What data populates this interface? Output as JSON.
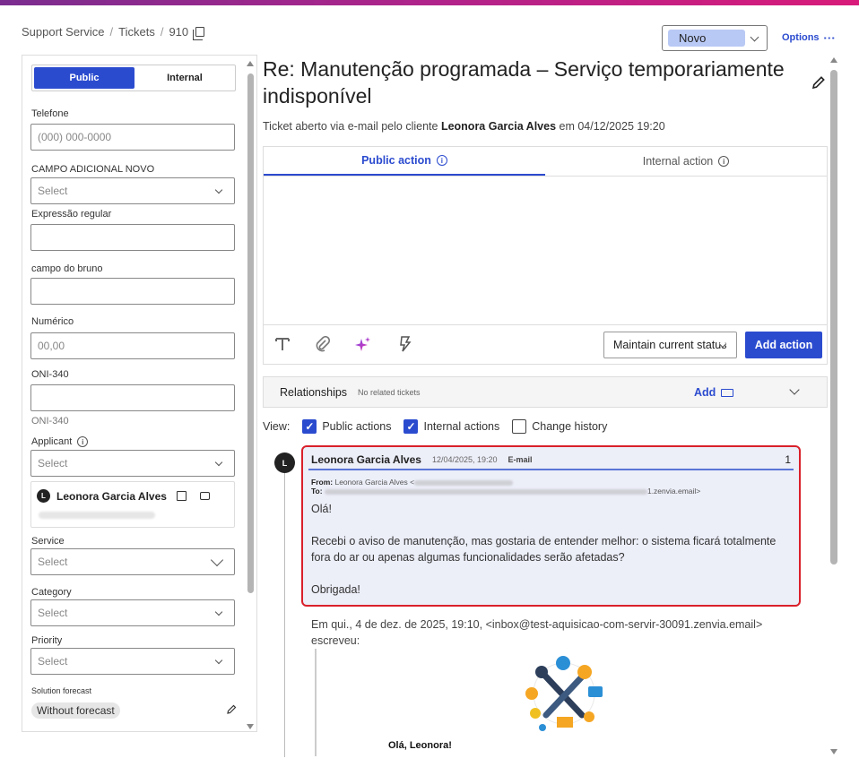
{
  "breadcrumb": {
    "root": "Support Service",
    "section": "Tickets",
    "id": "910"
  },
  "status": {
    "value": "Novo"
  },
  "options_label": "Options",
  "left": {
    "toggle": {
      "public": "Public",
      "internal": "Internal"
    },
    "fields": {
      "telefone": {
        "label": "Telefone",
        "placeholder": "(000) 000-0000"
      },
      "campo_adicional": {
        "label": "CAMPO ADICIONAL NOVO",
        "value": "Select"
      },
      "expressao": {
        "label": "Expressão regular"
      },
      "campo_bruno": {
        "label": "campo do bruno"
      },
      "numerico": {
        "label": "Numérico",
        "placeholder": "00,00"
      },
      "oni": {
        "label": "ONI-340",
        "helper": "ONI-340"
      },
      "applicant": {
        "label": "Applicant",
        "value": "Select"
      },
      "service": {
        "label": "Service",
        "value": "Select"
      },
      "category": {
        "label": "Category",
        "value": "Select"
      },
      "priority": {
        "label": "Priority",
        "value": "Select"
      },
      "solution": {
        "label": "Solution forecast",
        "value": "Without forecast"
      }
    },
    "applicant_card": {
      "initial": "L",
      "name": "Leonora Garcia Alves"
    }
  },
  "ticket": {
    "title": "Re: Manutenção programada – Serviço temporariamente indisponível",
    "subtitle_prefix": "Ticket aberto via e-mail pelo cliente",
    "subtitle_name": "Leonora Garcia Alves",
    "subtitle_suffix": "em 04/12/2025 19:20"
  },
  "editor": {
    "tab_public": "Public action",
    "tab_internal": "Internal action",
    "status_select": "Maintain current status",
    "add_action": "Add action"
  },
  "relationships": {
    "title": "Relationships",
    "note": "No related tickets",
    "add": "Add"
  },
  "view": {
    "label": "View:",
    "public_actions": "Public actions",
    "internal_actions": "Internal actions",
    "change_history": "Change history"
  },
  "message": {
    "initial": "L",
    "author": "Leonora Garcia Alves",
    "datetime": "12/04/2025, 19:20",
    "channel": "E-mail",
    "number": "1",
    "from_label": "From:",
    "from_value": "Leonora Garcia Alves <",
    "to_label": "To:",
    "to_suffix": "1.zenvia.email>",
    "greeting": "Olá!",
    "body": "Recebi o aviso de manutenção, mas gostaria de entender melhor: o sistema ficará totalmente fora do ar ou apenas algumas funcionalidades serão afetadas?",
    "closing": "Obrigada!"
  },
  "reply_quote": "Em qui., 4 de dez. de 2025, 19:10, <inbox@test-aquisicao-com-servir-30091.zenvia.email> escreveu:",
  "quote_greeting": "Olá, Leonora!",
  "colors": {
    "accent": "#2b4bcf",
    "highlight": "#d9202a",
    "status_pill": "#b9c9f5"
  }
}
